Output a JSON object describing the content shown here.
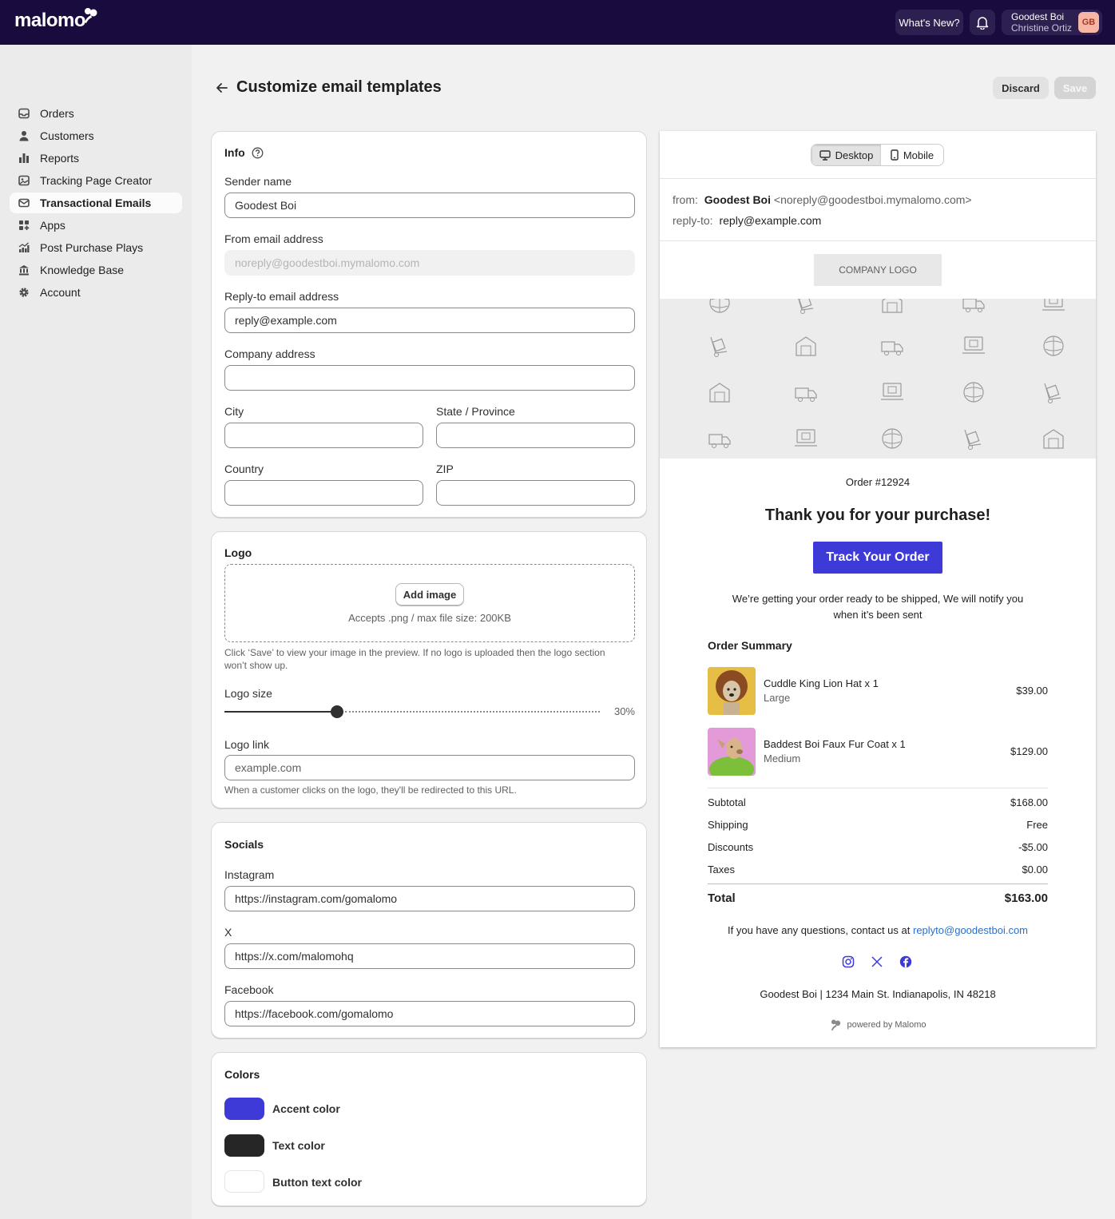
{
  "topbar": {
    "brand": "malomo",
    "whats_new": "What's New?",
    "account_name": "Goodest Boi",
    "account_user": "Christine Ortiz",
    "account_initials": "GB"
  },
  "sidebar": {
    "items": [
      {
        "label": "Orders",
        "icon": "inbox-icon"
      },
      {
        "label": "Customers",
        "icon": "person-icon"
      },
      {
        "label": "Reports",
        "icon": "bar-chart-icon"
      },
      {
        "label": "Tracking Page Creator",
        "icon": "image-icon"
      },
      {
        "label": "Transactional Emails",
        "icon": "mail-icon",
        "active": true
      },
      {
        "label": "Apps",
        "icon": "apps-icon"
      },
      {
        "label": "Post Purchase Plays",
        "icon": "chart-up-icon"
      },
      {
        "label": "Knowledge Base",
        "icon": "bank-icon"
      },
      {
        "label": "Account",
        "icon": "gear-icon"
      }
    ]
  },
  "page": {
    "title": "Customize email templates",
    "discard": "Discard",
    "save": "Save"
  },
  "info": {
    "title": "Info",
    "sender_name_label": "Sender name",
    "sender_name_value": "Goodest Boi",
    "from_email_label": "From email address",
    "from_email_value": "noreply@goodestboi.mymalomo.com",
    "reply_to_label": "Reply-to email address",
    "reply_to_value": "reply@example.com",
    "company_address_label": "Company address",
    "company_address_value": "",
    "city_label": "City",
    "state_label": "State / Province",
    "country_label": "Country",
    "zip_label": "ZIP"
  },
  "logo": {
    "title": "Logo",
    "add_image": "Add image",
    "accepts": "Accepts .png / max file size: 200KB",
    "help_line1": "Click ‘Save’ to view your image in the preview. If no logo is uploaded then the logo section",
    "help_line2": "won’t show up.",
    "size_label": "Logo size",
    "size_value": "30%",
    "size_fraction": 0.3,
    "link_label": "Logo link",
    "link_placeholder": "example.com",
    "link_help": "When a customer clicks on the logo, they'll be redirected to this URL."
  },
  "socials": {
    "title": "Socials",
    "instagram_label": "Instagram",
    "instagram_value": "https://instagram.com/gomalomo",
    "x_label": "X",
    "x_value": "https://x.com/malomohq",
    "facebook_label": "Facebook",
    "facebook_value": "https://facebook.com/gomalomo"
  },
  "colors": {
    "title": "Colors",
    "accent_label": "Accent color",
    "accent": "#3d3ad8",
    "text_label": "Text color",
    "text": "#262626",
    "button_text_label": "Button text color",
    "button_text": "#ffffff"
  },
  "preview": {
    "desktop": "Desktop",
    "mobile": "Mobile",
    "from_label": "from:",
    "from_name": "Goodest Boi",
    "from_email": "<noreply@goodestboi.mymalomo.com>",
    "reply_label": "reply-to:",
    "reply_value": "reply@example.com",
    "company_logo": "COMPANY LOGO",
    "order_number": "Order #12924",
    "heading": "Thank you for your purchase!",
    "track_button": "Track Your Order",
    "message_line1": "We’re getting your order ready to be shipped, We will notify you",
    "message_line2": "when it’s been sent",
    "summary_title": "Order Summary",
    "items": [
      {
        "name": "Cuddle King Lion Hat x 1",
        "variant": "Large",
        "price": "$39.00"
      },
      {
        "name": "Baddest Boi Faux Fur Coat x 1",
        "variant": "Medium",
        "price": "$129.00"
      }
    ],
    "subtotal_label": "Subtotal",
    "subtotal": "$168.00",
    "shipping_label": "Shipping",
    "shipping": "Free",
    "discounts_label": "Discounts",
    "discounts": "-$5.00",
    "taxes_label": "Taxes",
    "taxes": "$0.00",
    "total_label": "Total",
    "total": "$163.00",
    "contact_text": "If you have any questions, contact us at",
    "contact_email": "replyto@goodestboi.com",
    "footer_address": "Goodest Boi | 1234 Main St. Indianapolis, IN 48218",
    "powered_by": "powered by Malomo"
  }
}
